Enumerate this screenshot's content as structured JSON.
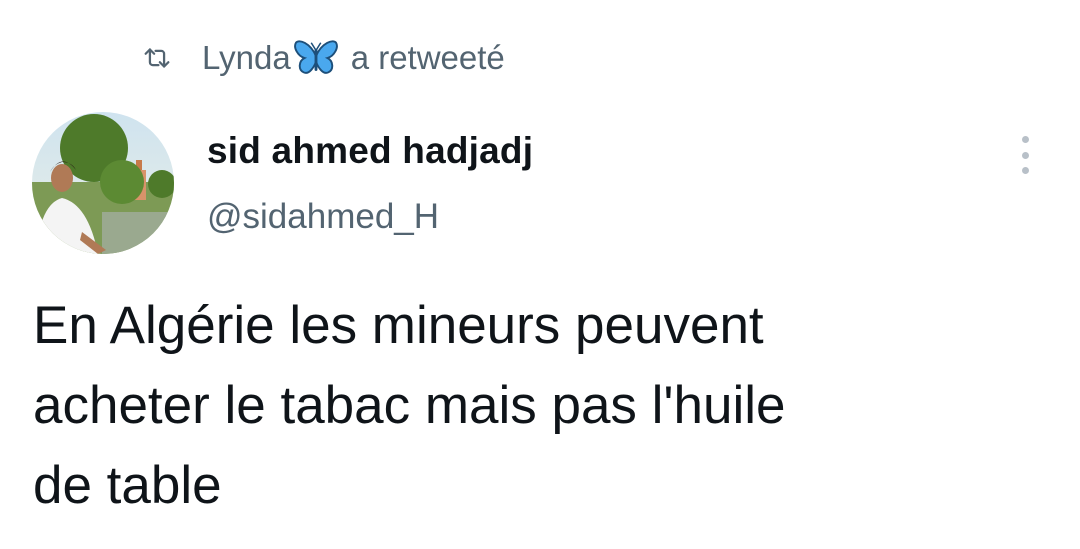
{
  "retweet": {
    "icon": "retweet-icon",
    "name": "Lynda",
    "emoji_icon": "butterfly-icon",
    "label": "a retweeté"
  },
  "author": {
    "display_name": "sid ahmed hadjadj",
    "handle": "@sidahmed_H",
    "avatar": "avatar-photo"
  },
  "menu": {
    "icon": "more-vertical-icon"
  },
  "tweet": {
    "lines": [
      "En Algérie les mineurs peuvent",
      "acheter le tabac mais pas l'huile",
      "de table"
    ]
  },
  "colors": {
    "text_primary": "#0f1419",
    "text_secondary": "#536471",
    "butterfly": "#3aa0e8"
  }
}
